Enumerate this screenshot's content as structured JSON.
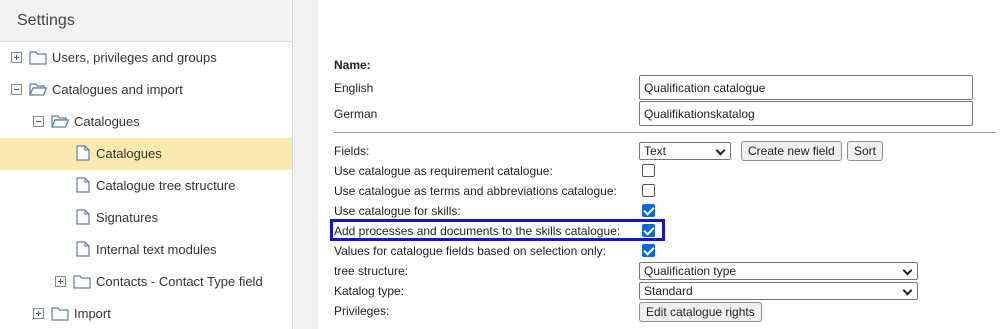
{
  "sidebar": {
    "title": "Settings",
    "items": [
      {
        "label": "Users, privileges and groups"
      },
      {
        "label": "Catalogues and import"
      },
      {
        "label": "Catalogues"
      },
      {
        "label": "Catalogues"
      },
      {
        "label": "Catalogue tree structure"
      },
      {
        "label": "Signatures"
      },
      {
        "label": "Internal text modules"
      },
      {
        "label": "Contacts - Contact Type field"
      },
      {
        "label": "Import"
      }
    ]
  },
  "form": {
    "name_heading": "Name:",
    "english_label": "English",
    "english_value": "Qualification catalogue",
    "german_label": "German",
    "german_value": "Qualifikationskatalog",
    "fields_label": "Fields:",
    "fields_select": "Text",
    "create_field_button": "Create new field",
    "sort_button": "Sort",
    "options": [
      {
        "label": "Use catalogue as requirement catalogue:",
        "checked": false
      },
      {
        "label": "Use catalogue as terms and abbreviations catalogue:",
        "checked": false
      },
      {
        "label": "Use catalogue for skills:",
        "checked": true
      },
      {
        "label": "Add processes and documents to the skills catalogue:",
        "checked": true
      },
      {
        "label": "Values for catalogue fields based on selection only:",
        "checked": true
      }
    ],
    "tree_structure_label": "tree structure:",
    "tree_structure_value": "Qualification type",
    "katalog_type_label": "Katalog type:",
    "katalog_type_value": "Standard",
    "privileges_label": "Privileges:",
    "edit_rights_button": "Edit catalogue rights"
  },
  "colors": {
    "selected_row": "#faeab0",
    "highlight_box": "#1414c8",
    "checkbox_checked": "#0a68d8"
  }
}
